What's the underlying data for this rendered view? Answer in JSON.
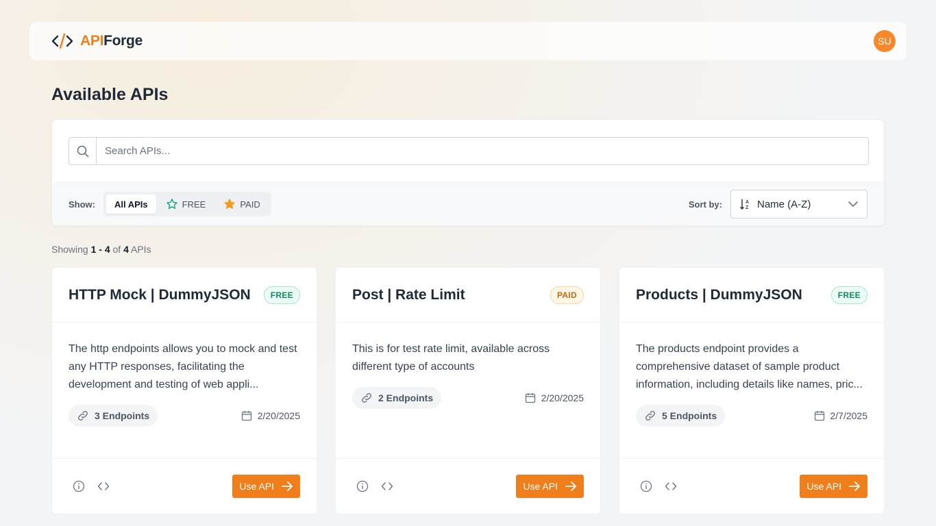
{
  "header": {
    "logo_part1": "API",
    "logo_part2": "Forge",
    "avatar_initials": "SU"
  },
  "page": {
    "title": "Available APIs"
  },
  "search": {
    "placeholder": "Search APIs..."
  },
  "filters": {
    "show_label": "Show:",
    "options": [
      {
        "label": "All APIs",
        "active": true
      },
      {
        "label": "FREE",
        "active": false
      },
      {
        "label": "PAID",
        "active": false
      }
    ],
    "sort_label": "Sort by:",
    "sort_value": "Name (A-Z)"
  },
  "results": {
    "prefix": "Showing",
    "range": "1 - 4",
    "of": "of",
    "total": "4",
    "suffix": "APIs"
  },
  "cards": [
    {
      "title": "HTTP Mock | DummyJSON",
      "badge": "FREE",
      "description": "The http endpoints allows you to mock and test any HTTP responses, facilitating the development and testing of web appli...",
      "endpoints": "3 Endpoints",
      "date": "2/20/2025",
      "button": "Use API"
    },
    {
      "title": "Post | Rate Limit",
      "badge": "PAID",
      "description": "This is for test rate limit, available across different type of accounts",
      "endpoints": "2 Endpoints",
      "date": "2/20/2025",
      "button": "Use API"
    },
    {
      "title": "Products | DummyJSON",
      "badge": "FREE",
      "description": "The products endpoint provides a comprehensive dataset of sample product information, including details like names, pric...",
      "endpoints": "5 Endpoints",
      "date": "2/7/2025",
      "button": "Use API"
    }
  ],
  "colors": {
    "accent": "#f07e1b",
    "free": "#0f8a5f",
    "paid": "#c2690f"
  }
}
